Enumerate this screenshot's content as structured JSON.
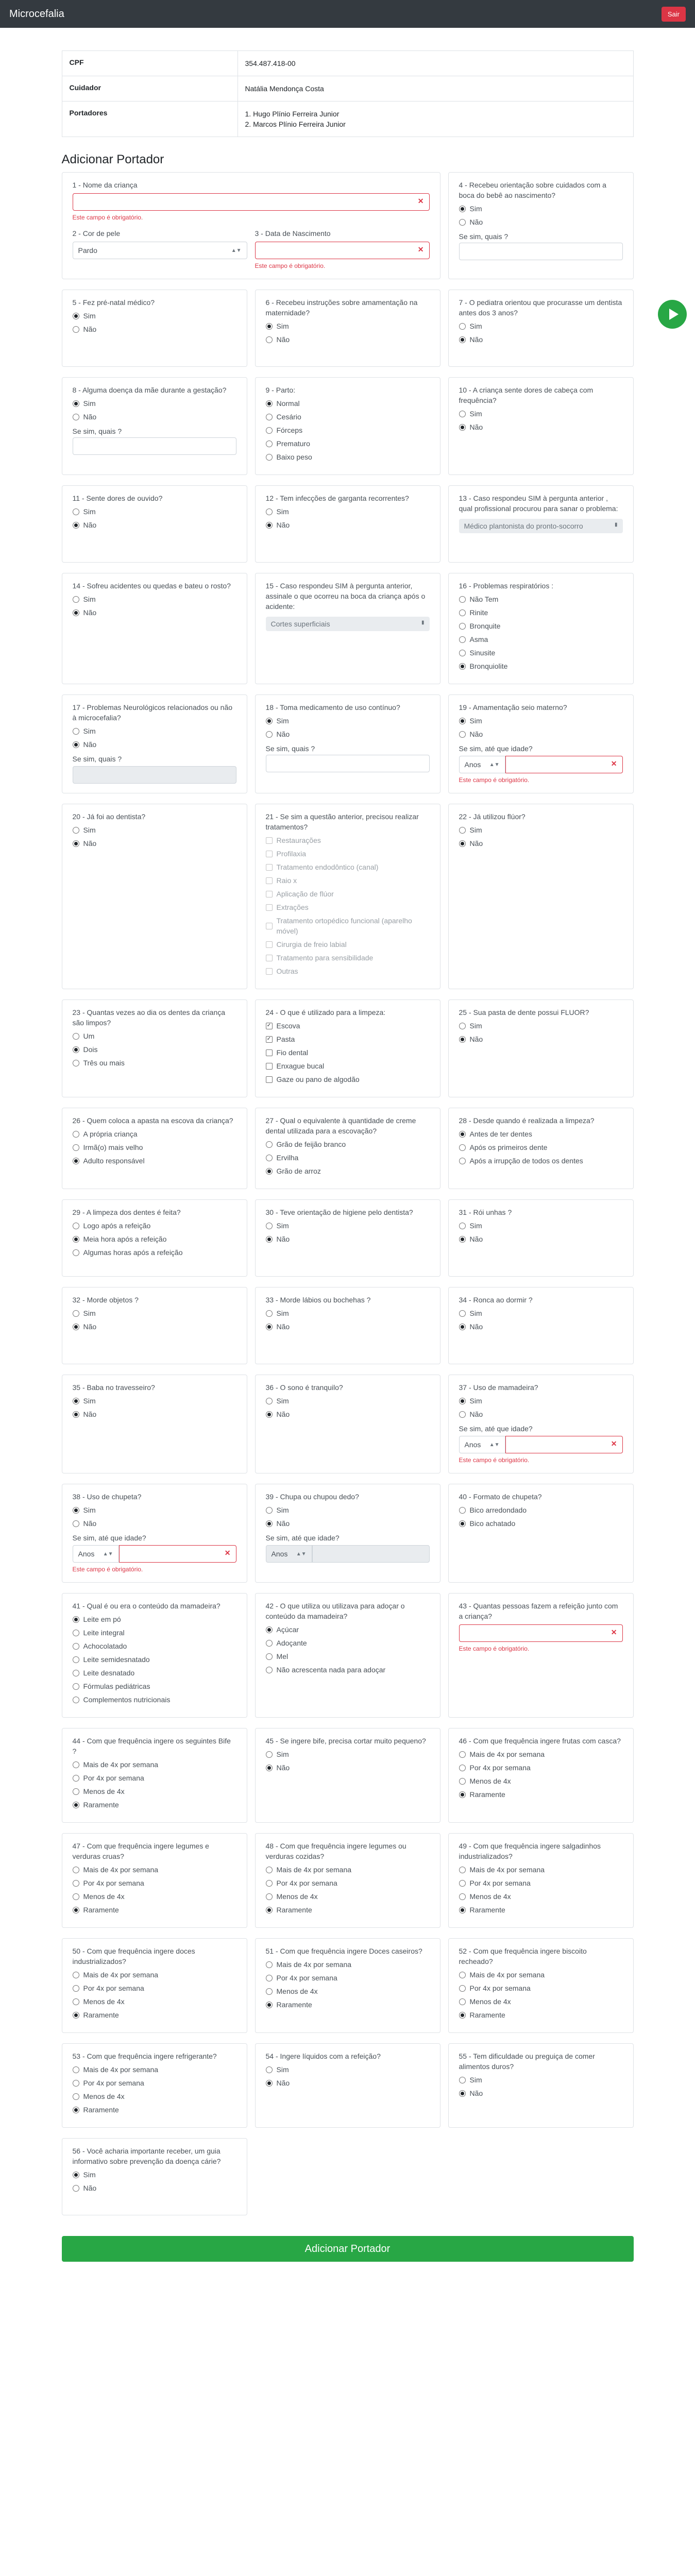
{
  "app": {
    "brand": "Microcefalia",
    "logout": "Sair"
  },
  "info": {
    "cpf_label": "CPF",
    "cpf": "354.487.418-00",
    "cuidador_label": "Cuidador",
    "cuidador": "Natália Mendonça Costa",
    "portadores_label": "Portadores",
    "portador_1": "1. Hugo Plínio Ferreira Junior",
    "portador_2": "2. Marcos Plínio Ferreira Junior"
  },
  "section_title": "Adicionar Portador",
  "required_msg": "Este campo é obrigatório.",
  "q1": {
    "label": "1 - Nome da criança"
  },
  "q2": {
    "label": "2 - Cor de pele",
    "value": "Pardo"
  },
  "q3": {
    "label": "3 - Data de Nascimento"
  },
  "q4": {
    "label": "4 - Recebeu orientação sobre cuidados com a boca do bebê ao nascimento?",
    "options": [
      "Sim",
      "Não"
    ],
    "sub": "Se sim, quais ?"
  },
  "q5": {
    "label": "5 - Fez pré-natal médico?",
    "options": [
      "Sim",
      "Não"
    ]
  },
  "q6": {
    "label": "6 - Recebeu instruções sobre amamentação na maternidade?",
    "options": [
      "Sim",
      "Não"
    ]
  },
  "q7": {
    "label": "7 - O pediatra orientou que procurasse um dentista antes dos 3 anos?",
    "options": [
      "Sim",
      "Não"
    ]
  },
  "q8": {
    "label": "8 - Alguma doença da mãe durante a gestação?",
    "options": [
      "Sim",
      "Não"
    ],
    "sub": "Se sim, quais ?"
  },
  "q9": {
    "label": "9 - Parto:",
    "options": [
      "Normal",
      "Cesário",
      "Fórceps",
      "Prematuro",
      "Baixo peso"
    ]
  },
  "q10": {
    "label": "10 - A criança sente dores de cabeça com frequência?",
    "options": [
      "Sim",
      "Não"
    ]
  },
  "q11": {
    "label": "11 - Sente dores de ouvido?",
    "options": [
      "Sim",
      "Não"
    ]
  },
  "q12": {
    "label": "12 - Tem infecções de garganta recorrentes?",
    "options": [
      "Sim",
      "Não"
    ]
  },
  "q13": {
    "label": "13 - Caso respondeu SIM à pergunta anterior , qual profissional procurou para sanar o problema:",
    "value": "Médico plantonista do pronto-socorro"
  },
  "q14": {
    "label": "14 - Sofreu acidentes ou quedas e bateu o rosto?",
    "options": [
      "Sim",
      "Não"
    ]
  },
  "q15": {
    "label": "15 - Caso respondeu SIM à pergunta anterior, assinale o que ocorreu na boca da criança após o acidente:",
    "value": "Cortes superficiais"
  },
  "q16": {
    "label": "16 - Problemas respiratórios :",
    "options": [
      "Não Tem",
      "Rinite",
      "Bronquite",
      "Asma",
      "Sinusite",
      "Bronquiolite"
    ]
  },
  "q17": {
    "label": "17 - Problemas Neurológicos relacionados ou não à microcefalia?",
    "options": [
      "Sim",
      "Não"
    ],
    "sub": "Se sim, quais ?"
  },
  "q18": {
    "label": "18 - Toma medicamento de uso contínuo?",
    "options": [
      "Sim",
      "Não"
    ],
    "sub": "Se sim, quais ?"
  },
  "q19": {
    "label": "19 - Amamentação seio materno?",
    "options": [
      "Sim",
      "Não"
    ],
    "sub": "Se sim, até que idade?",
    "unit": "Anos"
  },
  "q20": {
    "label": "20 - Já foi ao dentista?",
    "options": [
      "Sim",
      "Não"
    ]
  },
  "q21": {
    "label": "21 - Se sim a questão anterior, precisou realizar tratamentos?",
    "options": [
      "Restaurações",
      "Profilaxia",
      "Tratamento endodôntico (canal)",
      "Raio x",
      "Aplicação de flúor",
      "Extrações",
      "Tratamento ortopédico funcional (aparelho móvel)",
      "Cirurgia de freio labial",
      "Tratamento para sensibilidade",
      "Outras"
    ]
  },
  "q22": {
    "label": "22 - Já utilizou flúor?",
    "options": [
      "Sim",
      "Não"
    ]
  },
  "q23": {
    "label": "23 - Quantas vezes ao dia os dentes da criança são limpos?",
    "options": [
      "Um",
      "Dois",
      "Três ou mais"
    ]
  },
  "q24": {
    "label": "24 - O que é utilizado para a limpeza:",
    "options": [
      "Escova",
      "Pasta",
      "Fio dental",
      "Enxague bucal",
      "Gaze ou pano de algodão"
    ]
  },
  "q25": {
    "label": "25 - Sua pasta de dente possui FLUOR?",
    "options": [
      "Sim",
      "Não"
    ]
  },
  "q26": {
    "label": "26 - Quem coloca a apasta na escova da criança?",
    "options": [
      "A própria criança",
      "Irmã(o) mais velho",
      "Adulto responsável"
    ]
  },
  "q27": {
    "label": "27 - Qual o equivalente à quantidade de creme dental utilizada para a escovação?",
    "options": [
      "Grão de feijão branco",
      "Ervilha",
      "Grão de arroz"
    ]
  },
  "q28": {
    "label": "28 - Desde quando é realizada a limpeza?",
    "options": [
      "Antes de ter dentes",
      "Após os primeiros dente",
      "Após a irrupção de todos os dentes"
    ]
  },
  "q29": {
    "label": "29 - A limpeza dos dentes é feita?",
    "options": [
      "Logo após a refeição",
      "Meia hora após a refeição",
      "Algumas horas após a refeição"
    ]
  },
  "q30": {
    "label": "30 - Teve orientação de higiene pelo dentista?",
    "options": [
      "Sim",
      "Não"
    ]
  },
  "q31": {
    "label": "31 - Rói unhas ?",
    "options": [
      "Sim",
      "Não"
    ]
  },
  "q32": {
    "label": "32 - Morde objetos ?",
    "options": [
      "Sim",
      "Não"
    ]
  },
  "q33": {
    "label": "33 - Morde lábios ou bochehas ?",
    "options": [
      "Sim",
      "Não"
    ]
  },
  "q34": {
    "label": "34 - Ronca ao dormir ?",
    "options": [
      "Sim",
      "Não"
    ]
  },
  "q35": {
    "label": "35 - Baba no travesseiro?",
    "options": [
      "Sim",
      "Não"
    ]
  },
  "q36": {
    "label": "36 - O sono é tranquilo?",
    "options": [
      "Sim",
      "Não"
    ]
  },
  "q37": {
    "label": "37 - Uso de mamadeira?",
    "options": [
      "Sim",
      "Não"
    ],
    "sub": "Se sim, até que idade?",
    "unit": "Anos"
  },
  "q38": {
    "label": "38 - Uso de chupeta?",
    "options": [
      "Sim",
      "Não"
    ],
    "sub": "Se sim, até que idade?",
    "unit": "Anos"
  },
  "q39": {
    "label": "39 - Chupa ou chupou dedo?",
    "options": [
      "Sim",
      "Não"
    ],
    "sub": "Se sim, até que idade?",
    "unit": "Anos"
  },
  "q40": {
    "label": "40 - Formato de chupeta?",
    "options": [
      "Bico arredondado",
      "Bico achatado"
    ]
  },
  "q41": {
    "label": "41 - Qual é ou era o conteúdo da mamadeira?",
    "options": [
      "Leite em pó",
      "Leite integral",
      "Achocolatado",
      "Leite semidesnatado",
      "Leite desnatado",
      "Fórmulas pediátricas",
      "Complementos nutricionais"
    ]
  },
  "q42": {
    "label": "42 - O que utiliza ou utilizava para adoçar o conteúdo da mamadeira?",
    "options": [
      "Açúcar",
      "Adoçante",
      "Mel",
      "Não acrescenta nada para adoçar"
    ]
  },
  "q43": {
    "label": "43 - Quantas pessoas fazem a refeição junto com a criança?"
  },
  "q44": {
    "label": "44 - Com que frequência ingere os seguintes Bife ?",
    "options": [
      "Mais de 4x por semana",
      "Por 4x por semana",
      "Menos de 4x",
      "Raramente"
    ]
  },
  "q45": {
    "label": "45 - Se ingere bife, precisa cortar muito pequeno?",
    "options": [
      "Sim",
      "Não"
    ]
  },
  "q46": {
    "label": "46 - Com que frequência ingere frutas com casca?",
    "options": [
      "Mais de 4x por semana",
      "Por 4x por semana",
      "Menos de 4x",
      "Raramente"
    ]
  },
  "q47": {
    "label": "47 - Com que frequência ingere legumes e verduras cruas?",
    "options": [
      "Mais de 4x por semana",
      "Por 4x por semana",
      "Menos de 4x",
      "Raramente"
    ]
  },
  "q48": {
    "label": "48 - Com que frequência ingere legumes ou verduras cozidas?",
    "options": [
      "Mais de 4x por semana",
      "Por 4x por semana",
      "Menos de 4x",
      "Raramente"
    ]
  },
  "q49": {
    "label": "49 - Com que frequência ingere salgadinhos industrializados?",
    "options": [
      "Mais de 4x por semana",
      "Por 4x por semana",
      "Menos de 4x",
      "Raramente"
    ]
  },
  "q50": {
    "label": "50 - Com que frequência ingere doces industrializados?",
    "options": [
      "Mais de 4x por semana",
      "Por 4x por semana",
      "Menos de 4x",
      "Raramente"
    ]
  },
  "q51": {
    "label": "51 - Com que frequência ingere Doces caseiros?",
    "options": [
      "Mais de 4x por semana",
      "Por 4x por semana",
      "Menos de 4x",
      "Raramente"
    ]
  },
  "q52": {
    "label": "52 - Com que frequência ingere biscoito recheado?",
    "options": [
      "Mais de 4x por semana",
      "Por 4x por semana",
      "Menos de 4x",
      "Raramente"
    ]
  },
  "q53": {
    "label": "53 - Com que frequência ingere refrigerante?",
    "options": [
      "Mais de 4x por semana",
      "Por 4x por semana",
      "Menos de 4x",
      "Raramente"
    ]
  },
  "q54": {
    "label": "54 - Ingere líquidos com a refeição?",
    "options": [
      "Sim",
      "Não"
    ]
  },
  "q55": {
    "label": "55 - Tem dificuldade ou preguiça de comer alimentos duros?",
    "options": [
      "Sim",
      "Não"
    ]
  },
  "q56": {
    "label": "56 - Você acharia importante receber, um guia informativo sobre prevenção da doença cárie?",
    "options": [
      "Sim",
      "Não"
    ]
  },
  "submit": "Adicionar Portador"
}
